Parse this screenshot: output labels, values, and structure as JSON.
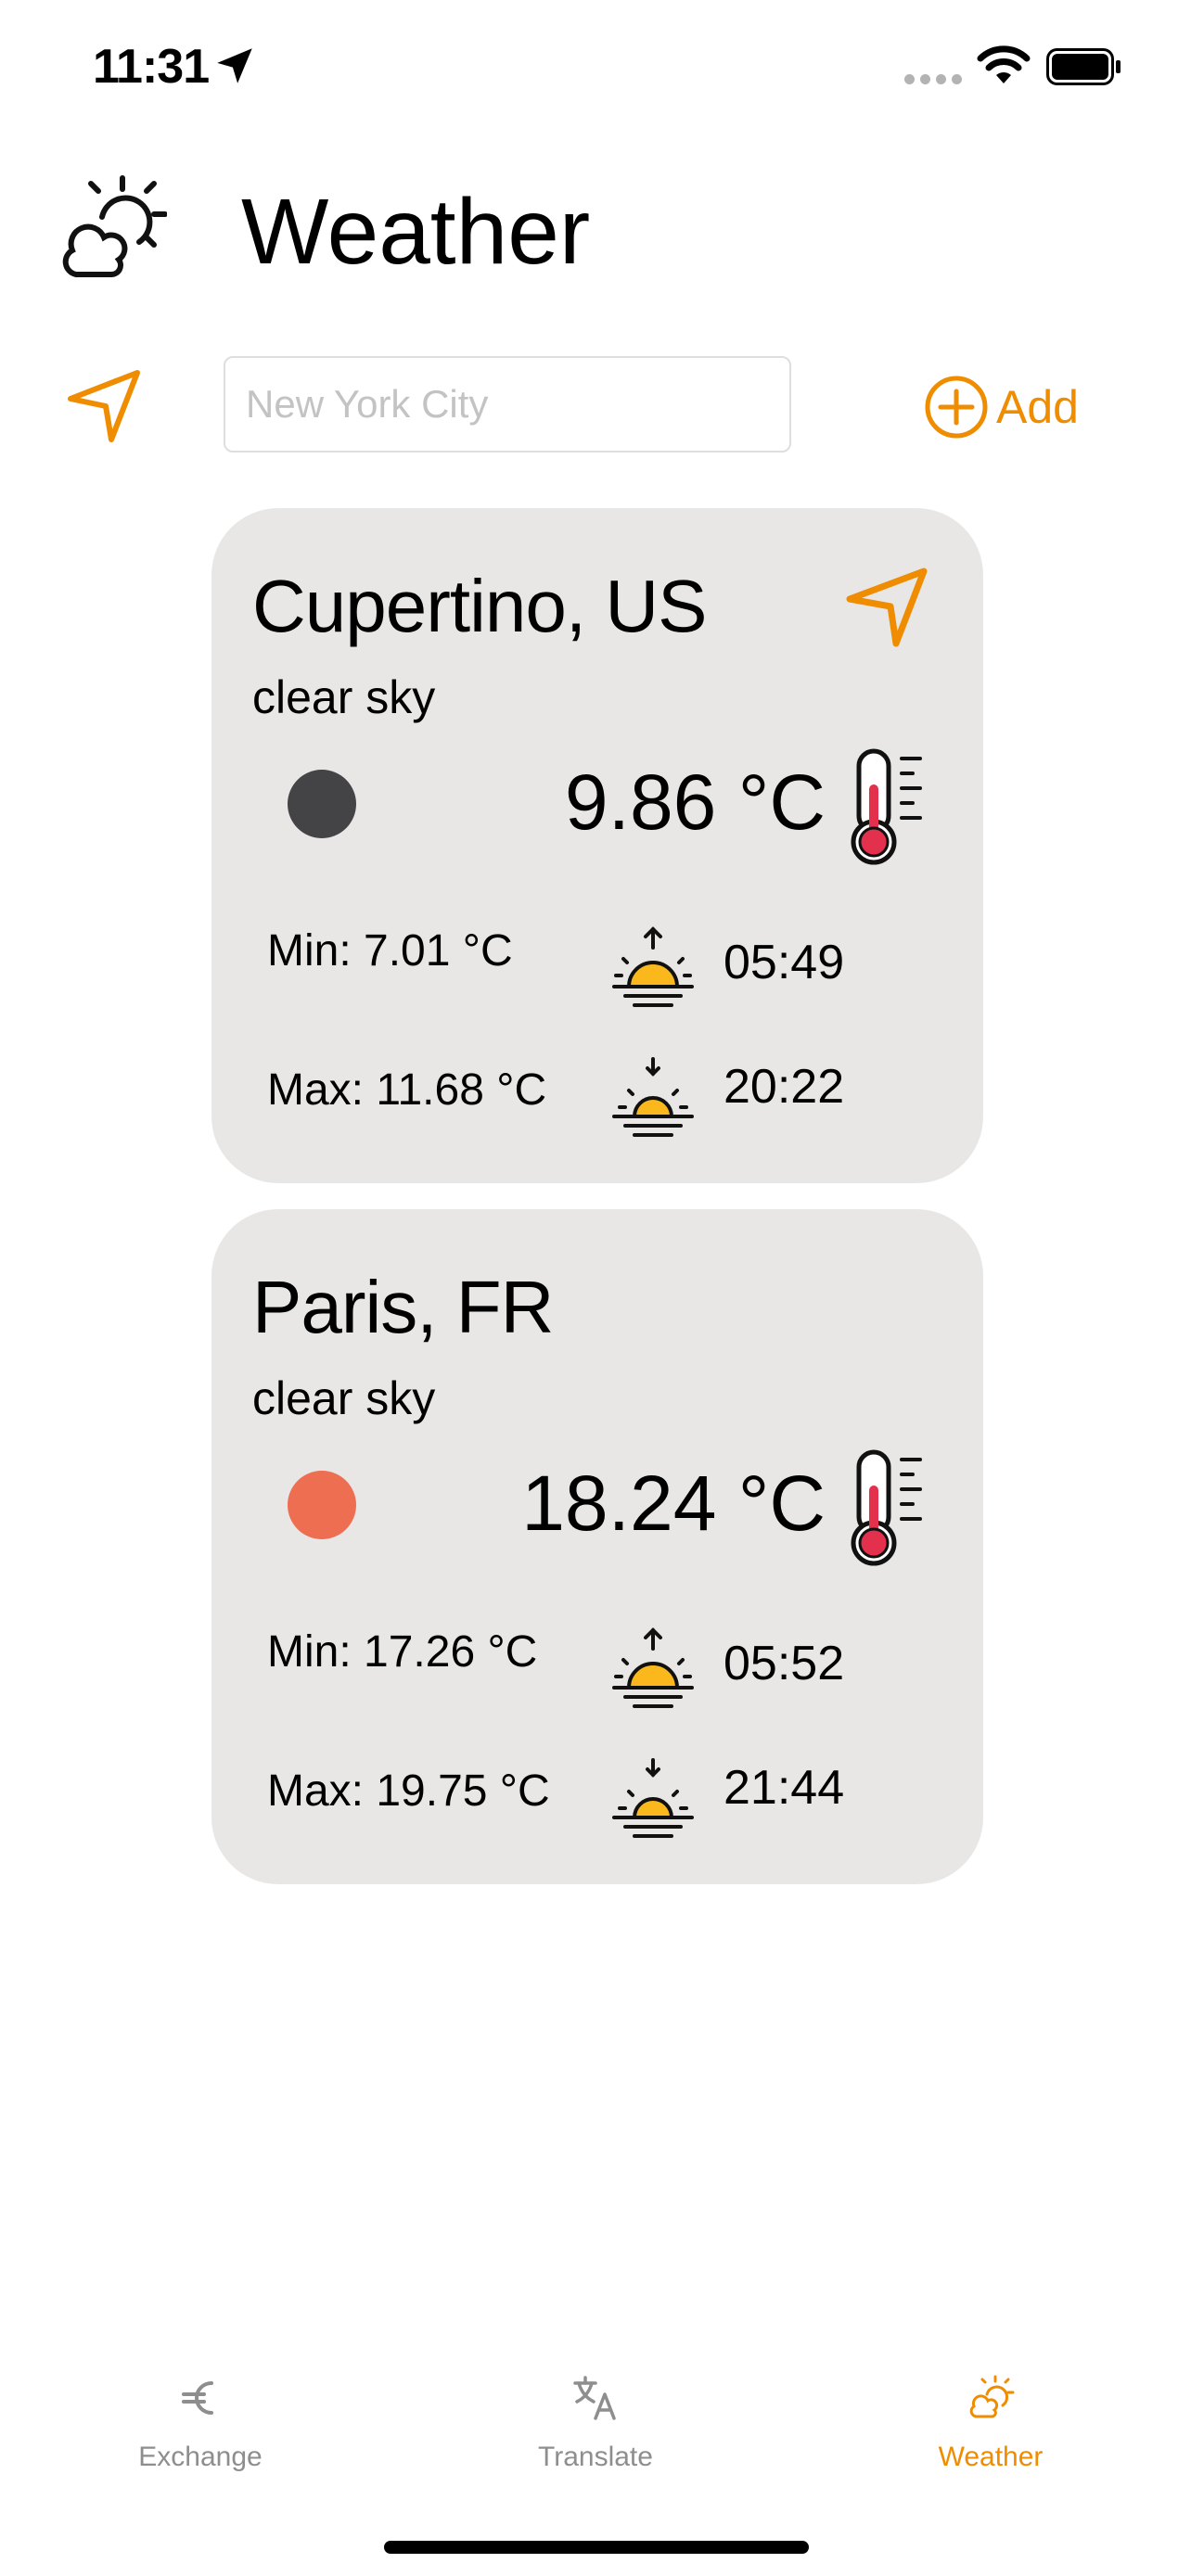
{
  "status_bar": {
    "time": "11:31"
  },
  "header": {
    "title": "Weather"
  },
  "search": {
    "placeholder": "New York City",
    "value": ""
  },
  "add_button": {
    "label": "Add"
  },
  "accent_color": "#f08c00",
  "cards": [
    {
      "city": "Cupertino, US",
      "description": "clear sky",
      "temperature": "9.86 °C",
      "min": "Min: 7.01 °C",
      "max": "Max: 11.68 °C",
      "sunrise": "05:49",
      "sunset": "20:22",
      "indicator_color": "#444446",
      "is_current_location": true
    },
    {
      "city": "Paris, FR",
      "description": "clear sky",
      "temperature": "18.24 °C",
      "min": "Min: 17.26 °C",
      "max": "Max: 19.75 °C",
      "sunrise": "05:52",
      "sunset": "21:44",
      "indicator_color": "#ee6e52",
      "is_current_location": false
    }
  ],
  "tab_bar": {
    "items": [
      {
        "label": "Exchange",
        "icon": "euro-icon",
        "active": false
      },
      {
        "label": "Translate",
        "icon": "translate-icon",
        "active": false
      },
      {
        "label": "Weather",
        "icon": "weather-icon",
        "active": true
      }
    ]
  }
}
